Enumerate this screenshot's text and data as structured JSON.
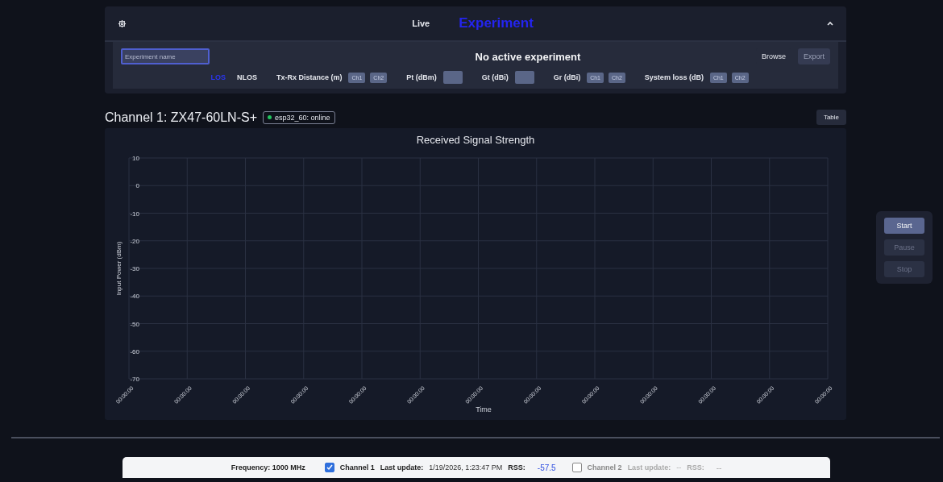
{
  "header": {
    "tabs": [
      {
        "label": "Live",
        "selected": false
      },
      {
        "label": "Experiment",
        "selected": true
      }
    ],
    "expanded": true
  },
  "experiment": {
    "name_field": {
      "placeholder": "Experiment name"
    },
    "status": "No active experiment",
    "buttons": [
      {
        "label": "Browse",
        "disabled": false
      },
      {
        "label": "Export",
        "disabled": true
      }
    ],
    "modes": [
      {
        "label": "LOS",
        "selected": true
      },
      {
        "label": "NLOS",
        "selected": false
      }
    ],
    "params": [
      {
        "label": "Tx-Rx Distance (m)",
        "kind": "pair",
        "chips": [
          "Ch1",
          "Ch2"
        ]
      },
      {
        "label": "Pt (dBm)",
        "kind": "field"
      },
      {
        "label": "Gt (dBi)",
        "kind": "field"
      },
      {
        "label": "Gr (dBi)",
        "kind": "pair",
        "chips": [
          "Ch1",
          "Ch2"
        ]
      },
      {
        "label": "System loss (dB)",
        "kind": "pair",
        "chips": [
          "Ch1",
          "Ch2"
        ]
      }
    ]
  },
  "channel": {
    "title": "Channel 1: ZX47-60LN-S+",
    "device": {
      "label": "esp32_60: online",
      "color": "#22c55e"
    },
    "table_button": "Table",
    "chart_data": {
      "type": "line",
      "title": "Received Signal Strength",
      "xlabel": "Time",
      "ylabel": "Input Power (dBm)",
      "categories": [
        "00:00:00",
        "00:00:00",
        "00:00:00",
        "00:00:00",
        "00:00:00",
        "00:00:00",
        "00:00:00",
        "00:00:00",
        "00:00:00",
        "00:00:00",
        "00:00:00",
        "00:00:00",
        "00:00:00"
      ],
      "grid": true,
      "ylim": [
        -70,
        10
      ],
      "yticks": [
        10,
        0,
        -10,
        -20,
        -30,
        -40,
        -50,
        -60,
        -70
      ]
    }
  },
  "controls": [
    {
      "label": "Start",
      "disabled": false
    },
    {
      "label": "Pause",
      "disabled": true
    },
    {
      "label": "Stop",
      "disabled": true
    }
  ],
  "status_bar": {
    "frequency": "Frequency: 1000 MHz",
    "channels": [
      {
        "name": "Channel 1",
        "checked": true,
        "update_label": "Last update:",
        "update": "1/19/2026, 1:23:47 PM",
        "rss_label": "RSS:",
        "rss": "-57.5"
      },
      {
        "name": "Channel 2",
        "checked": false,
        "update_label": "Last update:",
        "update": "--",
        "rss_label": "RSS:",
        "rss": "--"
      }
    ]
  }
}
